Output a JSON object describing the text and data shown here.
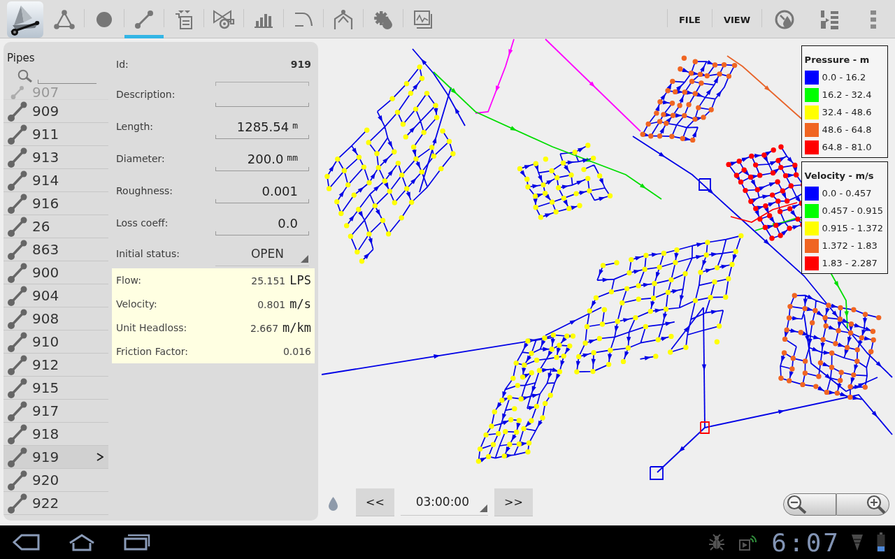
{
  "action_bar": {
    "tools": [
      {
        "kind": "network",
        "selected": false
      },
      {
        "kind": "junction",
        "selected": false
      },
      {
        "kind": "pipe",
        "selected": true
      },
      {
        "kind": "tank",
        "selected": false
      },
      {
        "kind": "pump",
        "selected": false
      },
      {
        "kind": "chart",
        "selected": false
      },
      {
        "kind": "curve",
        "selected": false
      },
      {
        "kind": "valve",
        "selected": false
      },
      {
        "kind": "options",
        "selected": false
      },
      {
        "kind": "report",
        "selected": false
      }
    ],
    "menu": [
      {
        "label": "FILE"
      },
      {
        "label": "VIEW"
      }
    ]
  },
  "pipes_list": {
    "title": "Pipes",
    "items": [
      {
        "label": "907",
        "selected": false
      },
      {
        "label": "909",
        "selected": false
      },
      {
        "label": "911",
        "selected": false
      },
      {
        "label": "913",
        "selected": false
      },
      {
        "label": "914",
        "selected": false
      },
      {
        "label": "916",
        "selected": false
      },
      {
        "label": "26",
        "selected": false
      },
      {
        "label": "863",
        "selected": false
      },
      {
        "label": "900",
        "selected": false
      },
      {
        "label": "904",
        "selected": false
      },
      {
        "label": "908",
        "selected": false
      },
      {
        "label": "910",
        "selected": false
      },
      {
        "label": "912",
        "selected": false
      },
      {
        "label": "915",
        "selected": false
      },
      {
        "label": "917",
        "selected": false
      },
      {
        "label": "918",
        "selected": false
      },
      {
        "label": "919",
        "selected": true
      },
      {
        "label": "920",
        "selected": false
      },
      {
        "label": "922",
        "selected": false
      }
    ]
  },
  "pipe_details": {
    "fields": [
      {
        "kind": "readonly",
        "label": "Id:",
        "value": "919"
      },
      {
        "kind": "input",
        "label": "Description:"
      },
      {
        "kind": "input",
        "label": "Length:",
        "value": "1285.54",
        "unit": "m"
      },
      {
        "kind": "input",
        "label": "Diameter:",
        "value": "200.0",
        "unit": "mm"
      },
      {
        "kind": "input",
        "label": "Roughness:",
        "value": "0.001"
      },
      {
        "kind": "input",
        "label": "Loss coeff:",
        "value": "0.0"
      },
      {
        "kind": "dropdown",
        "label": "Initial status:",
        "value": "OPEN"
      }
    ],
    "results": [
      {
        "label": "Flow:",
        "value": "25.151",
        "unit": "LPS"
      },
      {
        "label": "Velocity:",
        "value": "0.801",
        "unit": "m/s"
      },
      {
        "label": "Unit Headloss:",
        "value": "2.667",
        "unit": "m/km"
      },
      {
        "label": "Friction Factor:",
        "value": "0.016"
      }
    ]
  },
  "map": {
    "legends": [
      {
        "title": "Pressure - m",
        "entries": [
          {
            "label": "0.0 - 16.2",
            "color": "#0000ff"
          },
          {
            "label": "16.2 - 32.4",
            "color": "#00ff00"
          },
          {
            "label": "32.4 - 48.6",
            "color": "#ffff00"
          },
          {
            "label": "48.6 - 64.8",
            "color": "#f06522"
          },
          {
            "label": "64.8 - 81.0",
            "color": "#ff0000"
          }
        ]
      },
      {
        "title": "Velocity - m/s",
        "entries": [
          {
            "label": "0.0 - 0.457",
            "color": "#0000ff"
          },
          {
            "label": "0.457 - 0.915",
            "color": "#00ff00"
          },
          {
            "label": "0.915 - 1.372",
            "color": "#ffff00"
          },
          {
            "label": "1.372 - 1.83",
            "color": "#f06522"
          },
          {
            "label": "1.83 - 2.287",
            "color": "#ff0000"
          }
        ]
      }
    ],
    "playback": {
      "previous": "<<",
      "time": "03:00:00",
      "next": ">>"
    }
  },
  "status_bar": {
    "time": "6:07"
  }
}
